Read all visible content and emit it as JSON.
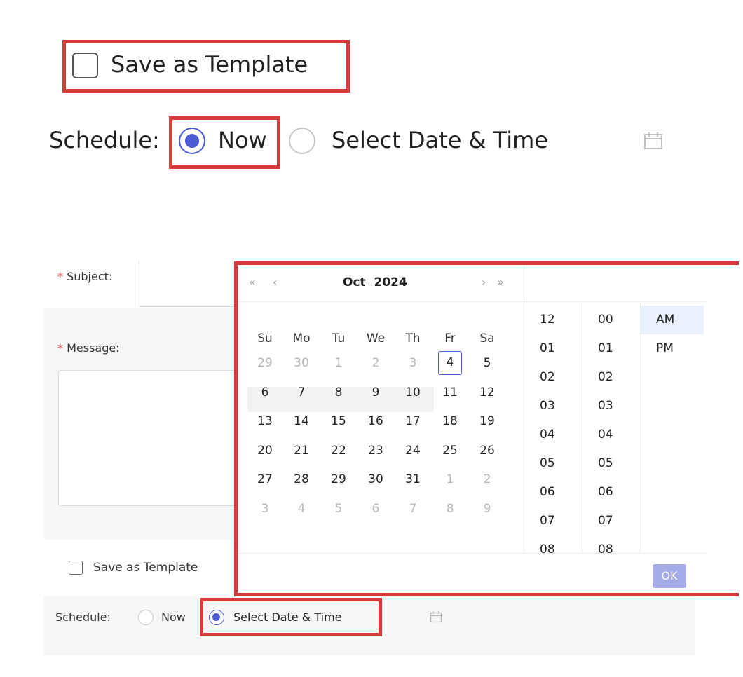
{
  "top": {
    "template_label": "Save as Template",
    "schedule_label": "Schedule:",
    "now_label": "Now",
    "select_label": "Select Date & Time"
  },
  "form": {
    "subject_label": "Subject:",
    "message_label": "Message:",
    "required_mark": "*",
    "template_label": "Save as Template",
    "schedule_label": "Schedule:",
    "now_label": "Now",
    "select_label": "Select Date & Time"
  },
  "picker": {
    "nav": {
      "prev_year": "«",
      "prev_month": "‹",
      "next_month": "›",
      "next_year": "»"
    },
    "month": "Oct",
    "year": "2024",
    "weekdays": [
      "Su",
      "Mo",
      "Tu",
      "We",
      "Th",
      "Fr",
      "Sa"
    ],
    "weeks": [
      [
        "29",
        "30",
        "1",
        "2",
        "3",
        "4",
        "5"
      ],
      [
        "6",
        "7",
        "8",
        "9",
        "10",
        "11",
        "12"
      ],
      [
        "13",
        "14",
        "15",
        "16",
        "17",
        "18",
        "19"
      ],
      [
        "20",
        "21",
        "22",
        "23",
        "24",
        "25",
        "26"
      ],
      [
        "27",
        "28",
        "29",
        "30",
        "31",
        "1",
        "2"
      ],
      [
        "3",
        "4",
        "5",
        "6",
        "7",
        "8",
        "9"
      ]
    ],
    "hours": [
      "12",
      "01",
      "02",
      "03",
      "04",
      "05",
      "06",
      "07",
      "08"
    ],
    "minutes": [
      "00",
      "01",
      "02",
      "03",
      "04",
      "05",
      "06",
      "07",
      "08"
    ],
    "ampm": [
      "AM",
      "PM"
    ],
    "ok_label": "OK"
  },
  "colors": {
    "accent": "#4a5bd4",
    "highlight_border": "#d63a3a",
    "required": "#e0524a",
    "ok_button": "#a4abe6"
  }
}
